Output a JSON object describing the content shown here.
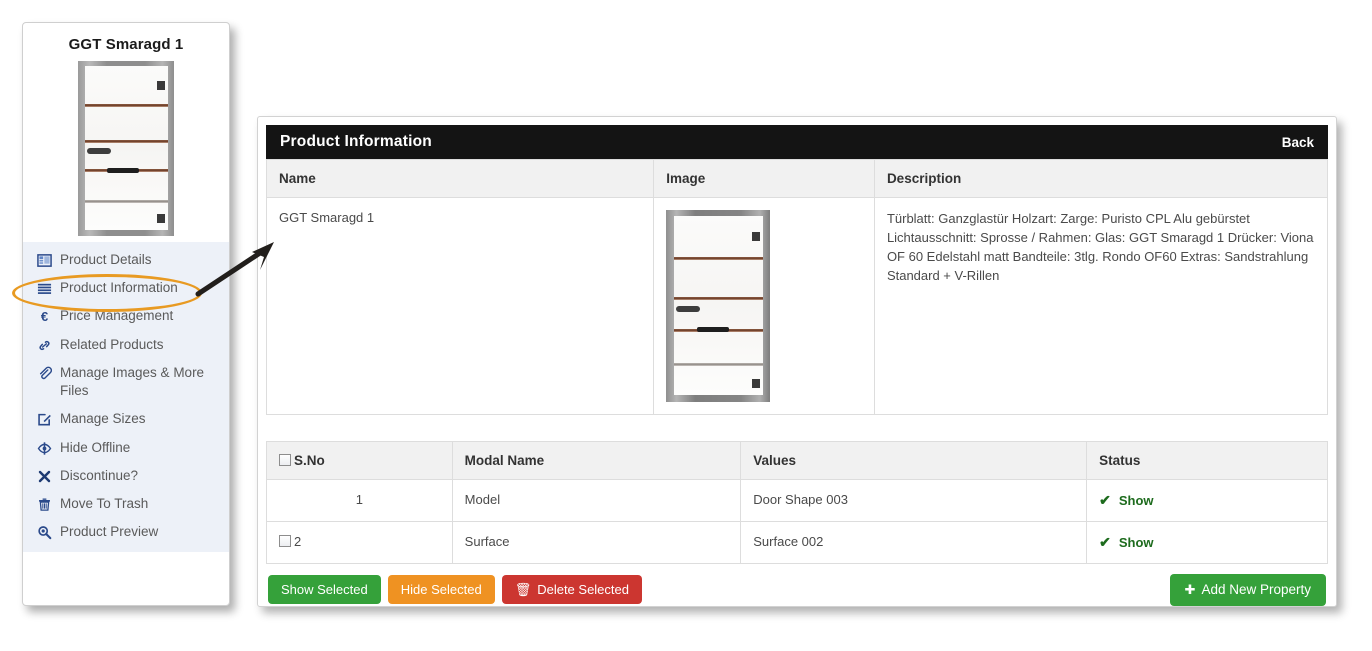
{
  "sidebar": {
    "product_title": "GGT Smaragd 1",
    "thumbnail_alt": "door-thumbnail",
    "items": [
      {
        "label": "Product Details",
        "icon": "table-grid-icon",
        "selected": false
      },
      {
        "label": "Product Information",
        "icon": "list-lines-icon",
        "selected": true
      },
      {
        "label": "Price Management",
        "icon": "euro-icon",
        "selected": false
      },
      {
        "label": "Related Products",
        "icon": "link-chain-icon",
        "selected": false
      },
      {
        "label": "Manage Images & More Files",
        "icon": "paperclip-icon",
        "selected": false
      },
      {
        "label": "Manage Sizes",
        "icon": "edit-square-icon",
        "selected": false
      },
      {
        "label": "Hide Offline",
        "icon": "eye-slash-icon",
        "selected": false
      },
      {
        "label": "Discontinue?",
        "icon": "close-x-icon",
        "selected": false
      },
      {
        "label": "Move To Trash",
        "icon": "trash-icon",
        "selected": false
      },
      {
        "label": "Product Preview",
        "icon": "magnifier-icon",
        "selected": false
      }
    ]
  },
  "annotation": {
    "highlight_color": "#e89a22",
    "arrow_color": "#221f1c",
    "highlighted_item": "Product Information"
  },
  "panel": {
    "title": "Product Information",
    "back_label": "Back",
    "header_bg": "#141414"
  },
  "info_table": {
    "headers": [
      "Name",
      "Image",
      "Description"
    ],
    "row": {
      "name": "GGT Smaragd 1",
      "image_alt": "door-product-image",
      "description": "Türblatt: Ganzglastür Holzart: Zarge: Puristo CPL Alu gebürstet Lichtausschnitt: Sprosse / Rahmen: Glas: GGT Smaragd 1 Drücker: Viona OF 60 Edelstahl matt Bandteile: 3tlg. Rondo OF60 Extras: Sandstrahlung Standard + V-Rillen"
    }
  },
  "property_table": {
    "headers": [
      "S.No",
      "Modal Name",
      "Values",
      "Status"
    ],
    "header_checkbox_checked": false,
    "rows": [
      {
        "sno": "1",
        "has_checkbox": false,
        "checked": false,
        "modal_name": "Model",
        "value": "Door Shape 003",
        "status": "Show",
        "status_icon": "check-icon"
      },
      {
        "sno": "2",
        "has_checkbox": true,
        "checked": false,
        "modal_name": "Surface",
        "value": "Surface 002",
        "status": "Show",
        "status_icon": "check-icon"
      }
    ]
  },
  "actions": {
    "show_selected": "Show Selected",
    "hide_selected": "Hide Selected",
    "delete_selected": "Delete Selected",
    "add_new_property": "Add New Property",
    "colors": {
      "show": "#35a13a",
      "hide": "#ef9222",
      "delete": "#cc3630",
      "add": "#35a13a"
    }
  }
}
